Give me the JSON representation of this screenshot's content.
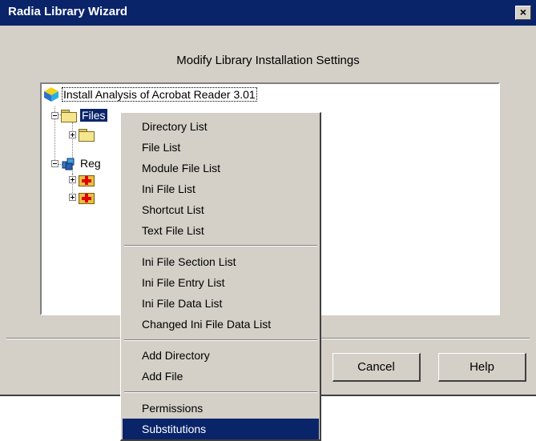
{
  "window": {
    "title": "Radia Library Wizard",
    "close_glyph": "×"
  },
  "dialog": {
    "heading": "Modify Library Installation Settings"
  },
  "tree": {
    "root_label": "Install Analysis of Acrobat Reader 3.01",
    "files_label": "Files",
    "registry_label": "Reg"
  },
  "buttons": {
    "cancel": "Cancel",
    "help": "Help"
  },
  "context_menu": {
    "items": [
      "Directory List",
      "File List",
      "Module File List",
      "Ini File List",
      "Shortcut List",
      "Text File List",
      "Ini File Section List",
      "Ini File Entry List",
      "Ini File Data List",
      "Changed Ini File Data List",
      "Add Directory",
      "Add File",
      "Permissions",
      "Substitutions"
    ],
    "selected": "Substitutions"
  },
  "colors": {
    "titlebar": "#0a246a",
    "dialog_bg": "#d4d0c8",
    "selection": "#0a246a"
  }
}
